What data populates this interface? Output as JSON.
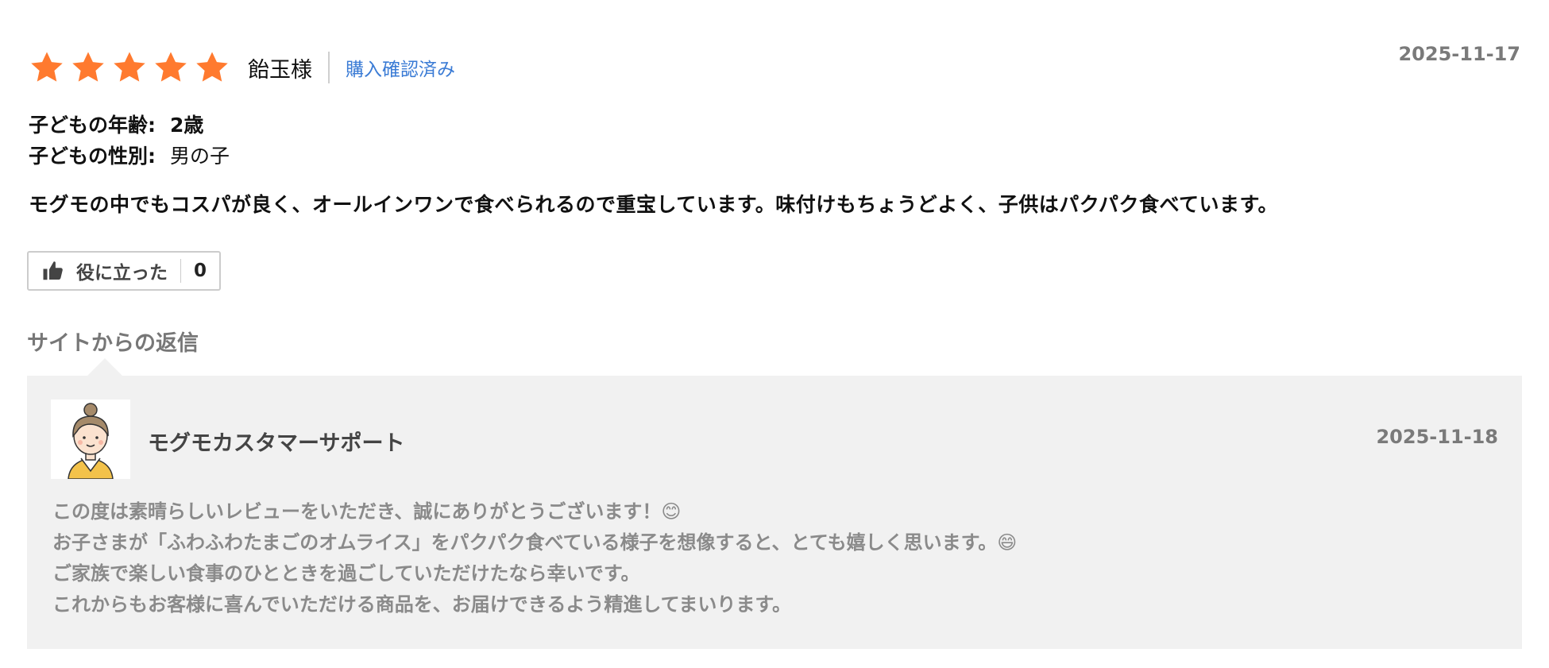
{
  "review": {
    "rating": 5,
    "rating_max": 5,
    "star_color": "#ff7a2f",
    "reviewer": "飴玉様",
    "verified": "購入確認済み",
    "date": "2025-11-17",
    "child_age_label": "子どもの年齢:",
    "child_age_value": "2歳",
    "child_gender_label": "子どもの性別:",
    "child_gender_value": "男の子",
    "body": "モグモの中でもコスパが良く、オールインワンで食べられるので重宝しています。味付けもちょうどよく、子供はパクパク食べています。"
  },
  "helpful": {
    "icon": "thumbs-up-icon",
    "label": "役に立った",
    "count": "0"
  },
  "reply": {
    "section_title": "サイトからの返信",
    "author": "モグモカスタマーサポート",
    "date": "2025-11-18",
    "avatar_icon": "support-woman-avatar",
    "lines": [
      "この度は素晴らしいレビューをいただき、誠にありがとうございます！😊",
      "お子さまが「ふわふわたまごのオムライス」をパクパク食べている様子を想像すると、とても嬉しく思います。😄",
      "ご家族で楽しい食事のひとときを過ごしていただけたなら幸いです。",
      "これからもお客様に喜んでいただける商品を、お届けできるよう精進してまいります。"
    ]
  }
}
